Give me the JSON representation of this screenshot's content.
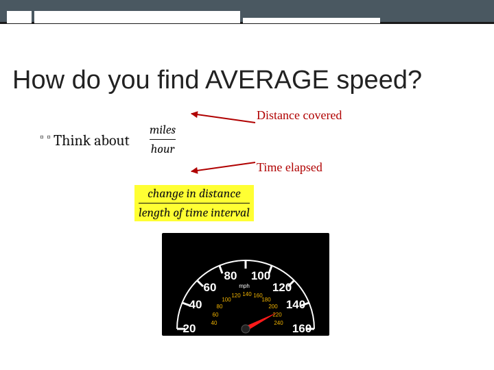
{
  "header": {},
  "title": "How do you find AVERAGE speed?",
  "bullet": {
    "dot": "▫\n▫",
    "think": "Think about"
  },
  "frac1": {
    "num": "miles",
    "den": "hour"
  },
  "annot": {
    "top": "Distance covered",
    "bot": "Time elapsed"
  },
  "frac2": {
    "num": "change in distance",
    "den": "length of time interval"
  },
  "gauge": {
    "outer": [
      "20",
      "40",
      "60",
      "80",
      "100",
      "120",
      "140",
      "160"
    ],
    "inner": [
      "40",
      "60",
      "80",
      "100",
      "120",
      "140",
      "160",
      "180",
      "200",
      "220",
      "240"
    ],
    "unit": "mph"
  }
}
